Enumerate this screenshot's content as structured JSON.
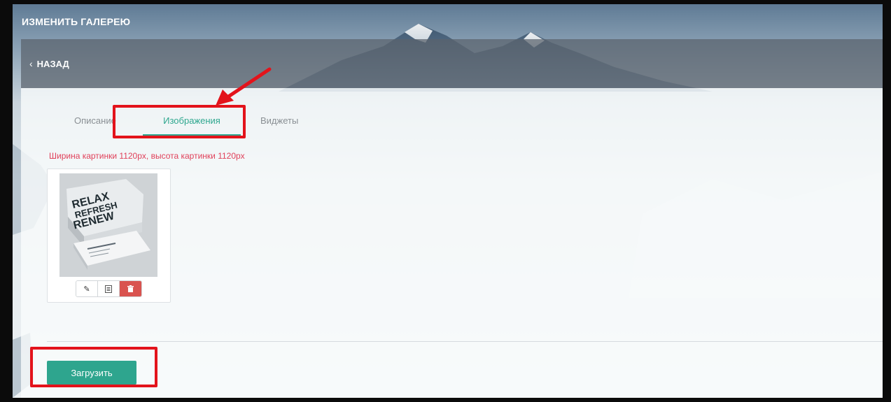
{
  "header": {
    "title": "ИЗМЕНИТЬ ГАЛЕРЕЮ"
  },
  "nav": {
    "back_label": "НАЗАД",
    "back_icon": "chevron-left-icon"
  },
  "tabs": [
    {
      "label": "Описание",
      "active": false
    },
    {
      "label": "Изображения",
      "active": true
    },
    {
      "label": "Виджеты",
      "active": false
    }
  ],
  "images_section": {
    "hint": "Ширина картинки 1120px, высота картинки 1120px",
    "thumbnail": {
      "headline_lines": [
        "RELAX",
        "REFRESH",
        "RENEW"
      ],
      "actions": [
        {
          "name": "edit",
          "icon": "pencil-icon"
        },
        {
          "name": "details",
          "icon": "form-icon"
        },
        {
          "name": "delete",
          "icon": "trash-icon"
        }
      ]
    }
  },
  "footer": {
    "upload_label": "Загрузить"
  },
  "colors": {
    "accent": "#2ea58e",
    "hint": "#e0415a",
    "danger": "#d9534f",
    "annotation": "#e3131b"
  }
}
